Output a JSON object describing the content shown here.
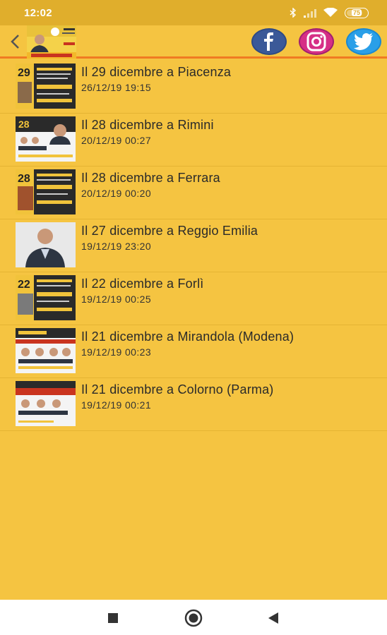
{
  "status_bar": {
    "time": "12:02",
    "battery": "75",
    "icons": [
      "bluetooth-icon",
      "signal-icon",
      "wifi-icon",
      "battery-icon"
    ]
  },
  "app_bar": {
    "back_icon": "chevron-left-icon",
    "logo_icon": "campaign-logo",
    "social": [
      "facebook-icon",
      "instagram-icon",
      "twitter-icon"
    ]
  },
  "colors": {
    "background": "#f5c441",
    "status_bar": "#e0ae2c",
    "accent_line": "#f07a22",
    "facebook": "#3b5998",
    "instagram": "#d62f86",
    "twitter": "#2a9fe8"
  },
  "news": [
    {
      "title": "Il 29 dicembre a Piacenza",
      "date": "26/12/19 19:15"
    },
    {
      "title": "Il 28 dicembre a Rimini",
      "date": "20/12/19 00:27"
    },
    {
      "title": "Il 28 dicembre a Ferrara",
      "date": "20/12/19 00:20"
    },
    {
      "title": "Il 27 dicembre a Reggio Emilia",
      "date": "19/12/19 23:20"
    },
    {
      "title": "Il 22 dicembre a Forlì",
      "date": "19/12/19 00:25"
    },
    {
      "title": "Il 21 dicembre a Mirandola (Modena)",
      "date": "19/12/19 00:23"
    },
    {
      "title": "Il 21 dicembre a Colorno (Parma)",
      "date": "19/12/19 00:21"
    }
  ],
  "nav_bar": [
    "recent-apps-icon",
    "home-icon",
    "back-icon"
  ]
}
